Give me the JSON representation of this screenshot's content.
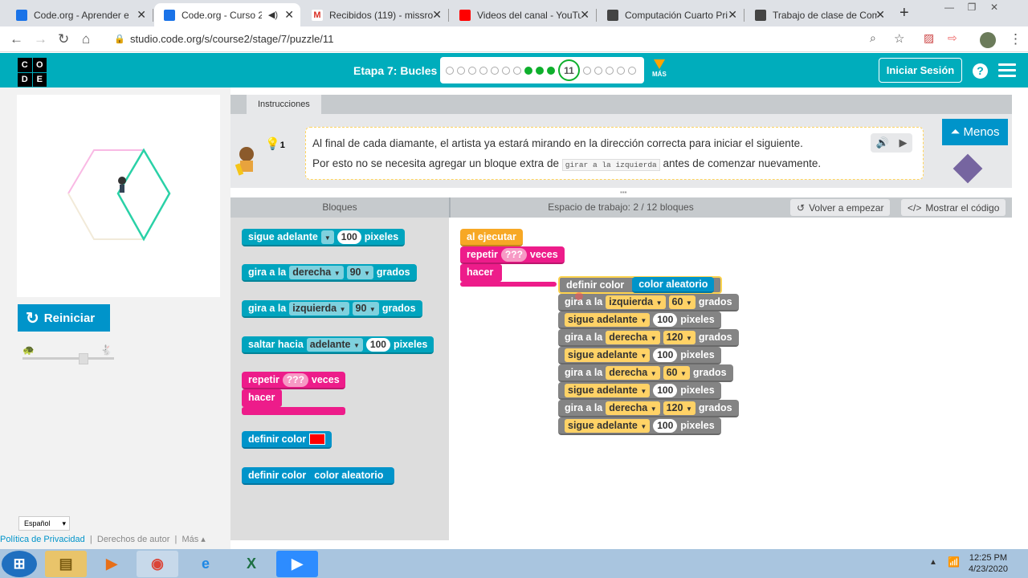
{
  "browser": {
    "tabs": [
      {
        "title": "Code.org - Aprender en",
        "color": "#1a73e8"
      },
      {
        "title": "Code.org - Curso 2:",
        "color": "#1a73e8"
      },
      {
        "title": "Recibidos (119) - missro",
        "color": "#d93025"
      },
      {
        "title": "Videos del canal - YouTu",
        "color": "#ff0000"
      },
      {
        "title": "Computación Cuarto Pri",
        "color": "#444444"
      },
      {
        "title": "Trabajo de clase de Com",
        "color": "#444444"
      }
    ],
    "url": "studio.code.org/s/course2/stage/7/puzzle/11"
  },
  "header": {
    "logo": [
      "C",
      "O",
      "D",
      "E"
    ],
    "stage_title": "Etapa 7: Bucles",
    "current_puzzle": "11",
    "mas_label": "MÁS",
    "sign_in": "Iniciar Sesión",
    "help": "?"
  },
  "left": {
    "reset_label": "Reiniciar",
    "language": "Español",
    "footer": {
      "privacy": "Política de Privacidad",
      "copyright": "Derechos de autor",
      "more": "Más ▴"
    }
  },
  "instructions": {
    "tab": "Instrucciones",
    "hint_count": "1",
    "line1": "Al final de cada diamante, el artista ya estará mirando en la dirección correcta para iniciar el siguiente.",
    "line2_pre": "Por esto no se necesita agregar un bloque extra de",
    "line2_code": "girar a la izquierda",
    "line2_post": "antes de comenzar nuevamente.",
    "menos": "Menos"
  },
  "workspace": {
    "blocks_title": "Bloques",
    "title": "Espacio de trabajo: 2 / 12 bloques",
    "restart": "Volver a empezar",
    "show_code": "Mostrar el código"
  },
  "toolbox": {
    "b1": {
      "label": "sigue adelante",
      "value": "100",
      "unit": "pixeles"
    },
    "b2": {
      "label": "gira a la",
      "dir": "derecha",
      "value": "90",
      "unit": "grados"
    },
    "b3": {
      "label": "gira a la",
      "dir": "izquierda",
      "value": "90",
      "unit": "grados"
    },
    "b4": {
      "label": "saltar hacia",
      "dir": "adelante",
      "value": "100",
      "unit": "pixeles"
    },
    "b5": {
      "label": "repetir",
      "value": "???",
      "unit": "veces",
      "do": "hacer"
    },
    "b6": {
      "label": "definir color",
      "swatch": "#ff0000"
    },
    "b7": {
      "label": "definir color",
      "value": "color aleatorio"
    }
  },
  "program": {
    "when_run": "al ejecutar",
    "repeat": {
      "label": "repetir",
      "value": "???",
      "unit": "veces",
      "do": "hacer"
    },
    "set_color": {
      "label": "definir color",
      "value": "color aleatorio"
    },
    "steps": [
      {
        "label": "gira a la",
        "dir": "izquierda",
        "value": "60",
        "unit": "grados"
      },
      {
        "label": "sigue adelante",
        "value": "100",
        "unit": "pixeles"
      },
      {
        "label": "gira a la",
        "dir": "derecha",
        "value": "120",
        "unit": "grados"
      },
      {
        "label": "sigue adelante",
        "value": "100",
        "unit": "pixeles"
      },
      {
        "label": "gira a la",
        "dir": "derecha",
        "value": "60",
        "unit": "grados"
      },
      {
        "label": "sigue adelante",
        "value": "100",
        "unit": "pixeles"
      },
      {
        "label": "gira a la",
        "dir": "derecha",
        "value": "120",
        "unit": "grados"
      },
      {
        "label": "sigue adelante",
        "value": "100",
        "unit": "pixeles"
      }
    ]
  },
  "taskbar": {
    "time": "12:25 PM",
    "date": "4/23/2020"
  }
}
